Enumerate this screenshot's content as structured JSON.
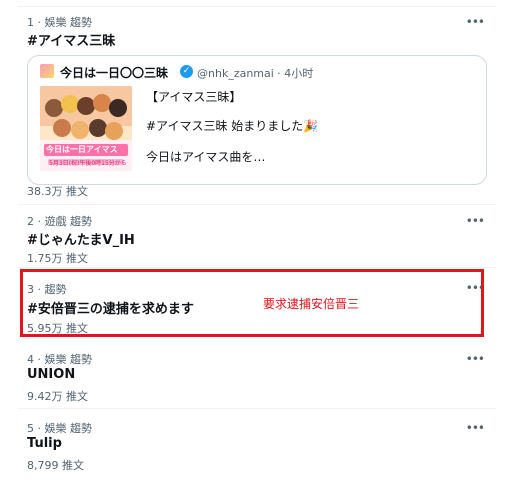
{
  "trends": [
    {
      "meta": "1 · 娛樂 趨勢",
      "title": "#アイマス三昧",
      "count": "38.3万 推文"
    },
    {
      "meta": "2 · 遊戲 趨勢",
      "title": "#じゃんたまV_IH",
      "count": "1.75万 推文"
    },
    {
      "meta": "3 · 趨勢",
      "title": "#安倍晋三の逮捕を求めます",
      "count": "5.95万 推文"
    },
    {
      "meta": "4 · 娛樂 趨勢",
      "title": "UNION",
      "count": "9.42万 推文"
    },
    {
      "meta": "5 · 娛樂 趨勢",
      "title": "Tulip",
      "count": "8,799 推文"
    }
  ],
  "more_icon": "•••",
  "card": {
    "name": "今日は一日〇〇三昧",
    "verified_icon": "✓",
    "handle": "@nhk_zanmai · 4小时",
    "lines": [
      "【アイマス三昧】",
      "#アイマス三昧 始まりました🎉",
      "今日はアイマス曲を…"
    ],
    "thumb_title": "今日は一日アイマス",
    "thumb_subtitle": "5月3日(祝)午後0時15分から"
  },
  "annotation": "要求逮捕安倍晋三",
  "colors": {
    "highlight": "#e3141b",
    "verified": "#1d9bf0"
  }
}
